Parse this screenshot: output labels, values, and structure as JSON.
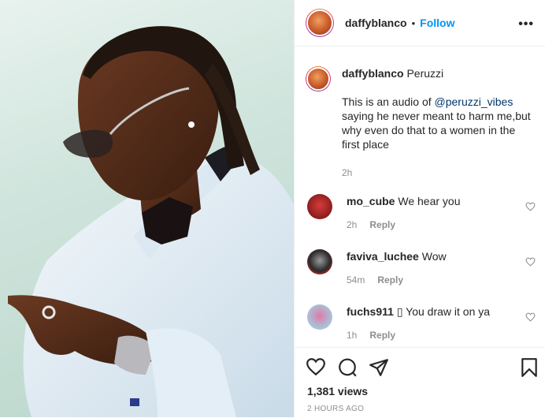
{
  "post": {
    "username": "daffyblanco",
    "follow_label": "Follow",
    "separator": "•",
    "more_label": "•••"
  },
  "caption": {
    "username": "daffyblanco",
    "first_line": "Peruzzi",
    "text_before_mention": "This is an audio of ",
    "mention": "@peruzzi_vibes",
    "text_after_mention": " saying he never meant to harm me,but why even do that to a women in the first place",
    "time": "2h"
  },
  "comments": [
    {
      "username": "mo_cube",
      "text": "We hear you",
      "time": "2h",
      "reply_label": "Reply"
    },
    {
      "username": "faviva_luchee",
      "text": "Wow",
      "time": "54m",
      "reply_label": "Reply"
    },
    {
      "username": "fuchs911",
      "text": "▯ You draw it on ya",
      "time": "1h",
      "reply_label": "Reply"
    }
  ],
  "footer": {
    "views": "1,381 views",
    "posted_ago": "2 HOURS AGO"
  },
  "icons": [
    "heart-icon",
    "comment-icon",
    "share-icon",
    "bookmark-icon",
    "more-icon"
  ],
  "colors": {
    "link": "#0095f6",
    "mention": "#00376b",
    "muted": "#8e8e8e",
    "text": "#262626"
  }
}
